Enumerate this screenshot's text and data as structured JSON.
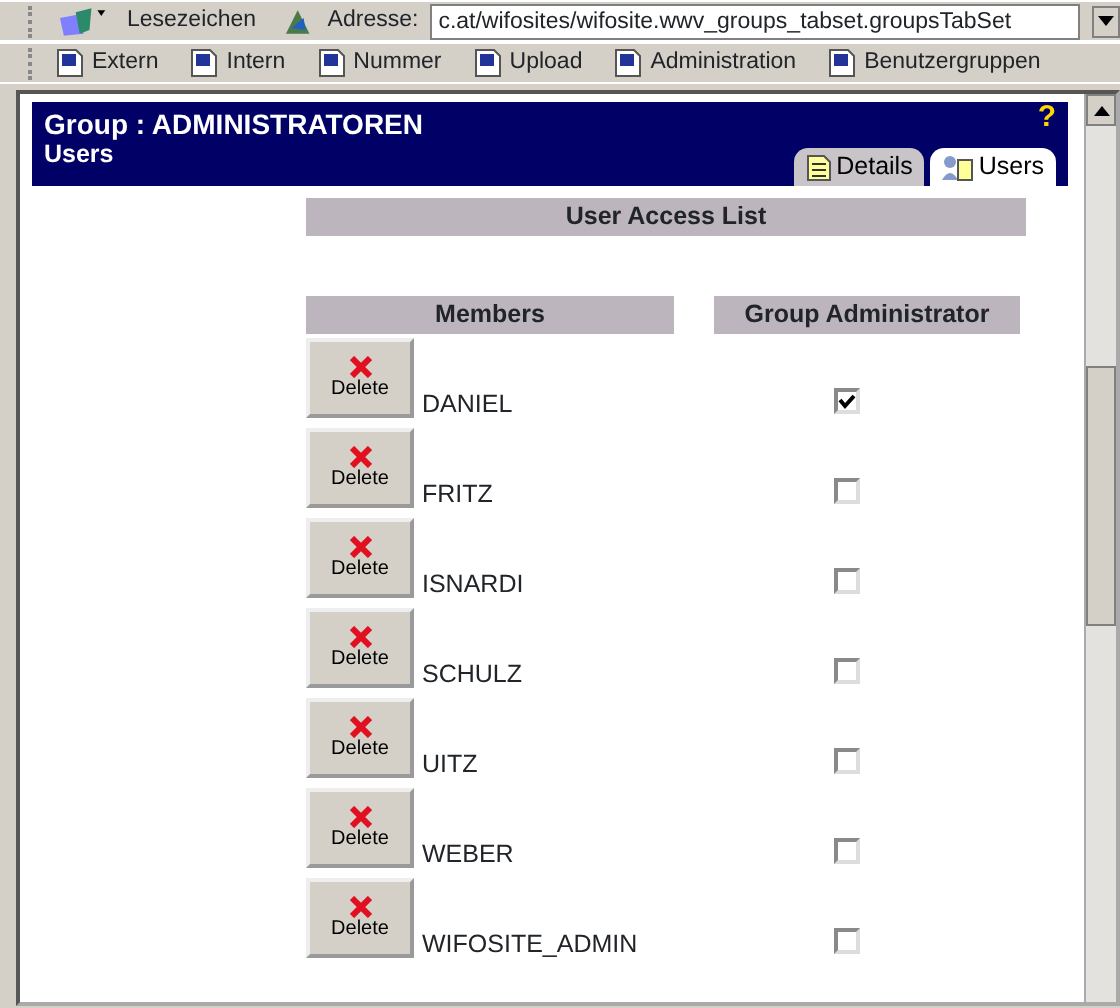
{
  "toolbar": {
    "bookmarks_label": "Lesezeichen",
    "address_label": "Adresse:",
    "address": "c.at/wifosites/wifosite.wwv_groups_tabset.groupsTabSet"
  },
  "links": [
    "Extern",
    "Intern",
    "Nummer",
    "Upload",
    "Administration",
    "Benutzergruppen"
  ],
  "header": {
    "title": "Group : ADMINISTRATOREN",
    "subtitle": "Users",
    "help": "?"
  },
  "tabs": [
    {
      "label": "Details",
      "selected": false
    },
    {
      "label": "Users",
      "selected": true
    }
  ],
  "section_title": "User Access List",
  "columns": [
    "Members",
    "Group Administrator"
  ],
  "members": [
    {
      "name": "DANIEL",
      "delete": "Delete",
      "admin": true
    },
    {
      "name": "FRITZ",
      "delete": "Delete",
      "admin": false
    },
    {
      "name": "ISNARDI",
      "delete": "Delete",
      "admin": false
    },
    {
      "name": "SCHULZ",
      "delete": "Delete",
      "admin": false
    },
    {
      "name": "UITZ",
      "delete": "Delete",
      "admin": false
    },
    {
      "name": "WEBER",
      "delete": "Delete",
      "admin": false
    },
    {
      "name": "WIFOSITE_ADMIN",
      "delete": "Delete",
      "admin": false
    }
  ]
}
